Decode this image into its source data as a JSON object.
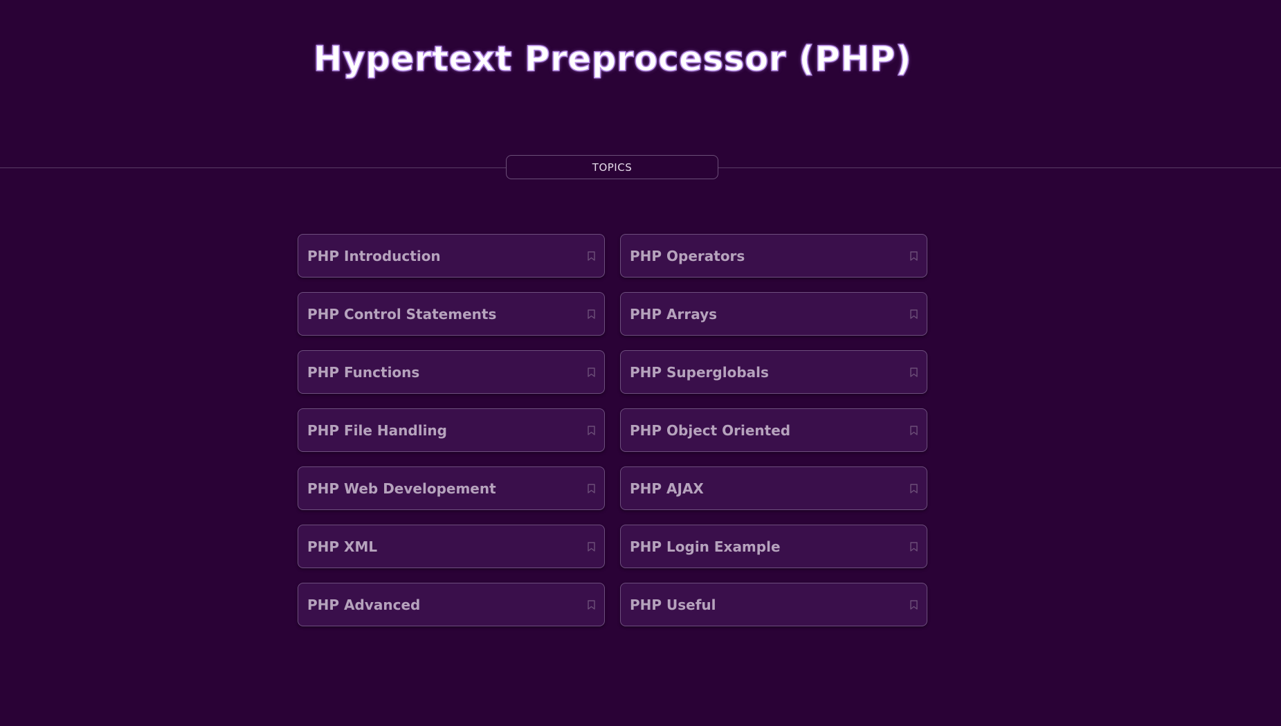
{
  "header": {
    "title": "Hypertext Preprocessor (PHP)"
  },
  "section": {
    "label": "TOPICS"
  },
  "topics": [
    {
      "label": "PHP Introduction",
      "icon": "bookmark-icon"
    },
    {
      "label": "PHP Operators",
      "icon": "bookmark-icon"
    },
    {
      "label": "PHP Control Statements",
      "icon": "bookmark-icon"
    },
    {
      "label": "PHP Arrays",
      "icon": "bookmark-icon"
    },
    {
      "label": "PHP Functions",
      "icon": "bookmark-icon"
    },
    {
      "label": "PHP Superglobals",
      "icon": "bookmark-icon"
    },
    {
      "label": "PHP File Handling",
      "icon": "bookmark-icon"
    },
    {
      "label": "PHP Object Oriented",
      "icon": "bookmark-icon"
    },
    {
      "label": "PHP Web Developement",
      "icon": "bookmark-icon"
    },
    {
      "label": "PHP AJAX",
      "icon": "bookmark-icon"
    },
    {
      "label": "PHP XML",
      "icon": "bookmark-icon"
    },
    {
      "label": "PHP Login Example",
      "icon": "bookmark-icon"
    },
    {
      "label": "PHP Advanced",
      "icon": "bookmark-icon"
    },
    {
      "label": "PHP Useful",
      "icon": "bookmark-icon"
    }
  ],
  "colors": {
    "background": "#2a0236",
    "card": "#3a0f4b",
    "card_border": "#6e4f7e",
    "title_glow": "#b58ae6",
    "label": "#b6a3bd"
  }
}
